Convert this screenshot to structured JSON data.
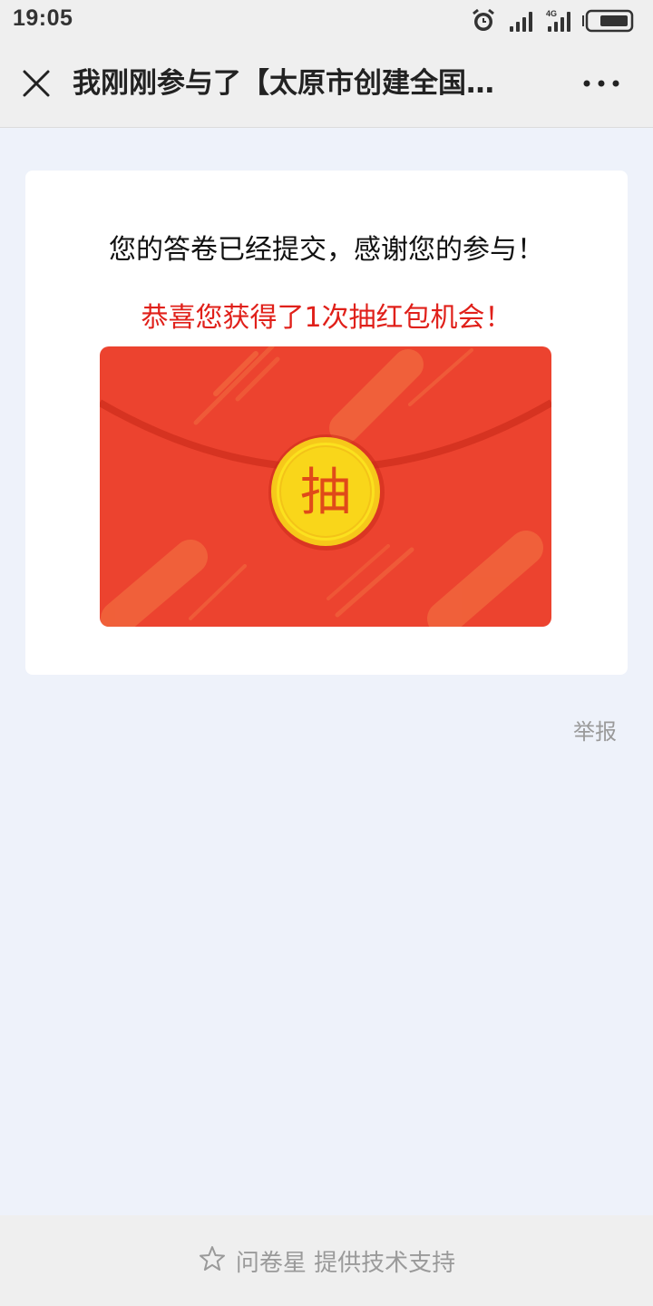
{
  "status_bar": {
    "time": "19:05",
    "network_label": "4G",
    "icons": [
      "alarm-icon",
      "signal-icon",
      "signal-4g-icon",
      "battery-icon"
    ]
  },
  "nav": {
    "title": "我刚刚参与了【太原市创建全国…",
    "close_icon": "close-icon",
    "more_icon": "more-icon"
  },
  "card": {
    "thanks_text": "您的答卷已经提交，感谢您的参与！",
    "congrats_text": "恭喜您获得了1次抽红包机会！",
    "envelope_button_label": "抽"
  },
  "report_label": "举报",
  "footer": {
    "text": "问卷星 提供技术支持",
    "icon": "star-icon"
  },
  "colors": {
    "envelope_red": "#ec432f",
    "coin_gold": "#f9d61a",
    "congrats_red": "#e0201a",
    "page_bg": "#eef2fa"
  }
}
